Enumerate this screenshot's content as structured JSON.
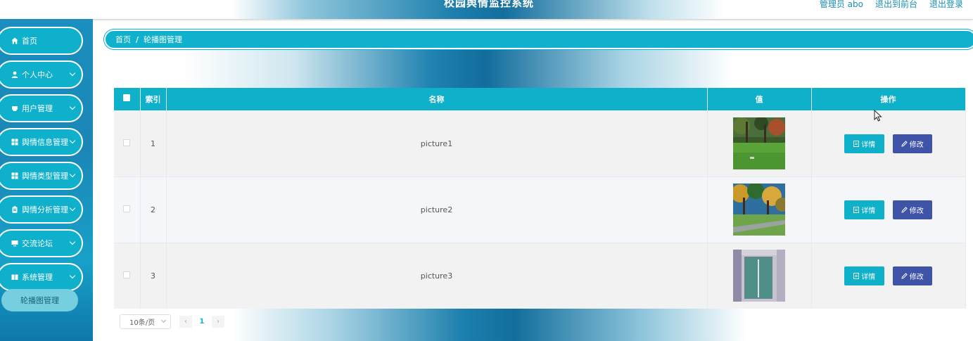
{
  "header": {
    "title": "校园舆情监控系统",
    "links": [
      "管理员 abo",
      "退出到前台",
      "退出登录"
    ]
  },
  "sidebar": {
    "items": [
      {
        "label": "首页",
        "icon": "home-icon",
        "has_children": false
      },
      {
        "label": "个人中心",
        "icon": "user-icon",
        "has_children": true
      },
      {
        "label": "用户管理",
        "icon": "printer-icon",
        "has_children": true
      },
      {
        "label": "舆情信息管理",
        "icon": "grid-icon",
        "has_children": true
      },
      {
        "label": "舆情类型管理",
        "icon": "grid-icon",
        "has_children": true
      },
      {
        "label": "舆情分析管理",
        "icon": "clipboard-icon",
        "has_children": true
      },
      {
        "label": "交流论坛",
        "icon": "monitor-icon",
        "has_children": true
      },
      {
        "label": "系统管理",
        "icon": "book-icon",
        "has_children": true
      }
    ],
    "submenu_active": "轮播图管理"
  },
  "breadcrumb": {
    "home": "首页",
    "separator": "/",
    "current": "轮播图管理"
  },
  "table": {
    "columns": [
      "索引",
      "名称",
      "值",
      "操作"
    ],
    "rows": [
      {
        "index": "1",
        "name": "picture1",
        "thumb": "park-lawn"
      },
      {
        "index": "2",
        "name": "picture2",
        "thumb": "autumn-trees"
      },
      {
        "index": "3",
        "name": "picture3",
        "thumb": "building-door"
      }
    ],
    "actions": {
      "detail": "详情",
      "edit": "修改"
    }
  },
  "pagination": {
    "page_size": "10条/页",
    "current_page": "1",
    "prev": "‹",
    "next": "›"
  },
  "colors": {
    "primary": "#0fb0ca",
    "edit_button": "#3f53a9",
    "link": "#1c8fb2"
  }
}
